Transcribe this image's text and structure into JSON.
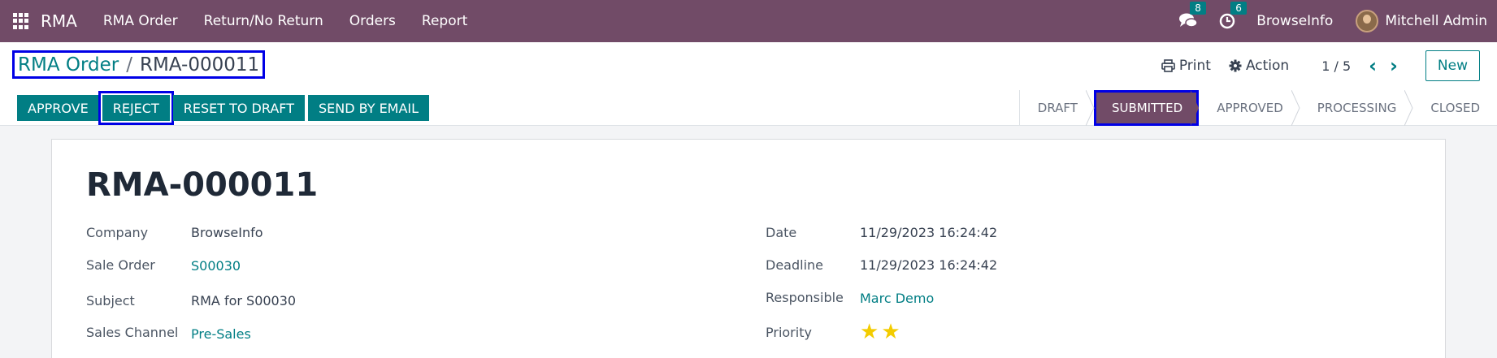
{
  "navbar": {
    "brand": "RMA",
    "menu": [
      "RMA Order",
      "Return/No Return",
      "Orders",
      "Report"
    ],
    "messages_count": "8",
    "activities_count": "6",
    "company": "BrowseInfo",
    "user": "Mitchell Admin",
    "accent_color": "#714b67"
  },
  "breadcrumb": {
    "parent": "RMA Order",
    "separator": "/",
    "current": "RMA-000011"
  },
  "control": {
    "print_label": "Print",
    "action_label": "Action",
    "pager": "1 / 5",
    "new_label": "New"
  },
  "status_buttons": [
    "APPROVE",
    "REJECT",
    "RESET TO DRAFT",
    "SEND BY EMAIL"
  ],
  "stages": [
    "DRAFT",
    "SUBMITTED",
    "APPROVED",
    "PROCESSING",
    "CLOSED"
  ],
  "active_stage": "SUBMITTED",
  "form": {
    "title": "RMA-000011",
    "left": [
      {
        "label": "Company",
        "value": "BrowseInfo"
      },
      {
        "label": "Sale Order",
        "value": "S00030"
      },
      {
        "label": "Subject",
        "value": "RMA for S00030"
      },
      {
        "label": "Sales Channel",
        "value": "Pre-Sales"
      }
    ],
    "right": [
      {
        "label": "Date",
        "value": "11/29/2023 16:24:42"
      },
      {
        "label": "Deadline",
        "value": "11/29/2023 16:24:42"
      },
      {
        "label": "Responsible",
        "value": "Marc Demo"
      },
      {
        "label": "Priority",
        "value": "2 of 2 stars"
      }
    ]
  }
}
